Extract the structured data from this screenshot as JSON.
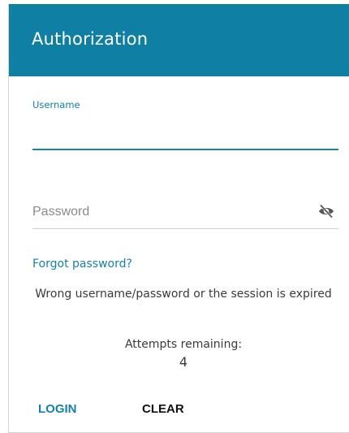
{
  "header": {
    "title": "Authorization"
  },
  "username": {
    "label": "Username",
    "value": ""
  },
  "password": {
    "placeholder": "Password",
    "toggle_icon": "eye-slash-icon"
  },
  "links": {
    "forgot": "Forgot password?"
  },
  "message": {
    "error": "Wrong username/password or the session is expired",
    "attempts_label": "Attempts remaining:",
    "attempts_count": "4"
  },
  "actions": {
    "login": "LOGIN",
    "clear": "CLEAR"
  },
  "colors": {
    "accent": "#0f7fa3",
    "link": "#1581a6"
  }
}
